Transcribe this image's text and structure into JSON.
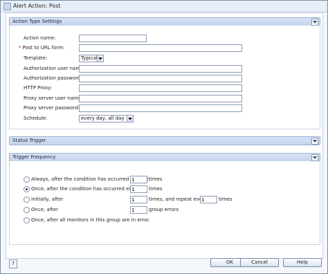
{
  "window": {
    "title": "Alert Action: Post"
  },
  "sections": {
    "action_type": {
      "title": "Action Type Settings"
    },
    "status_trigger": {
      "title": "Status Trigger"
    },
    "trigger_frequency": {
      "title": "Trigger Frequency"
    }
  },
  "form": {
    "action_name": {
      "label": "Action name:",
      "value": ""
    },
    "post_to_url": {
      "label": "Post to URL form:",
      "value": "",
      "required_marker": "*"
    },
    "template": {
      "label": "Template:",
      "value": "Typical"
    },
    "auth_user": {
      "label": "Authorization user name:",
      "value": ""
    },
    "auth_password": {
      "label": "Authorization password:",
      "value": ""
    },
    "http_proxy": {
      "label": "HTTP Proxy:",
      "value": ""
    },
    "proxy_user": {
      "label": "Proxy server user name:",
      "value": ""
    },
    "proxy_password": {
      "label": "Proxy server password:",
      "value": ""
    },
    "schedule": {
      "label": "Schedule:",
      "value": "every day, all day"
    }
  },
  "frequency": {
    "selected": "once_exactly",
    "options": {
      "always": {
        "label": "Always, after the condition has occurred at least",
        "count": "1",
        "suffix": "times"
      },
      "once_exactly": {
        "label": "Once, after the condition has occurred exactly",
        "count": "1",
        "suffix": "times"
      },
      "initially": {
        "label": "Initially, after",
        "count": "1",
        "mid": "times, and repeat every",
        "repeat": "1",
        "suffix": "times"
      },
      "once_after": {
        "label": "Once, after",
        "count": "1",
        "suffix": "group errors"
      },
      "all_monitors": {
        "label": "Once, after all monitors in this group are in error."
      }
    }
  },
  "footer": {
    "ok": "OK",
    "cancel": "Cancel",
    "help": "Help",
    "help_icon": "question-icon"
  }
}
